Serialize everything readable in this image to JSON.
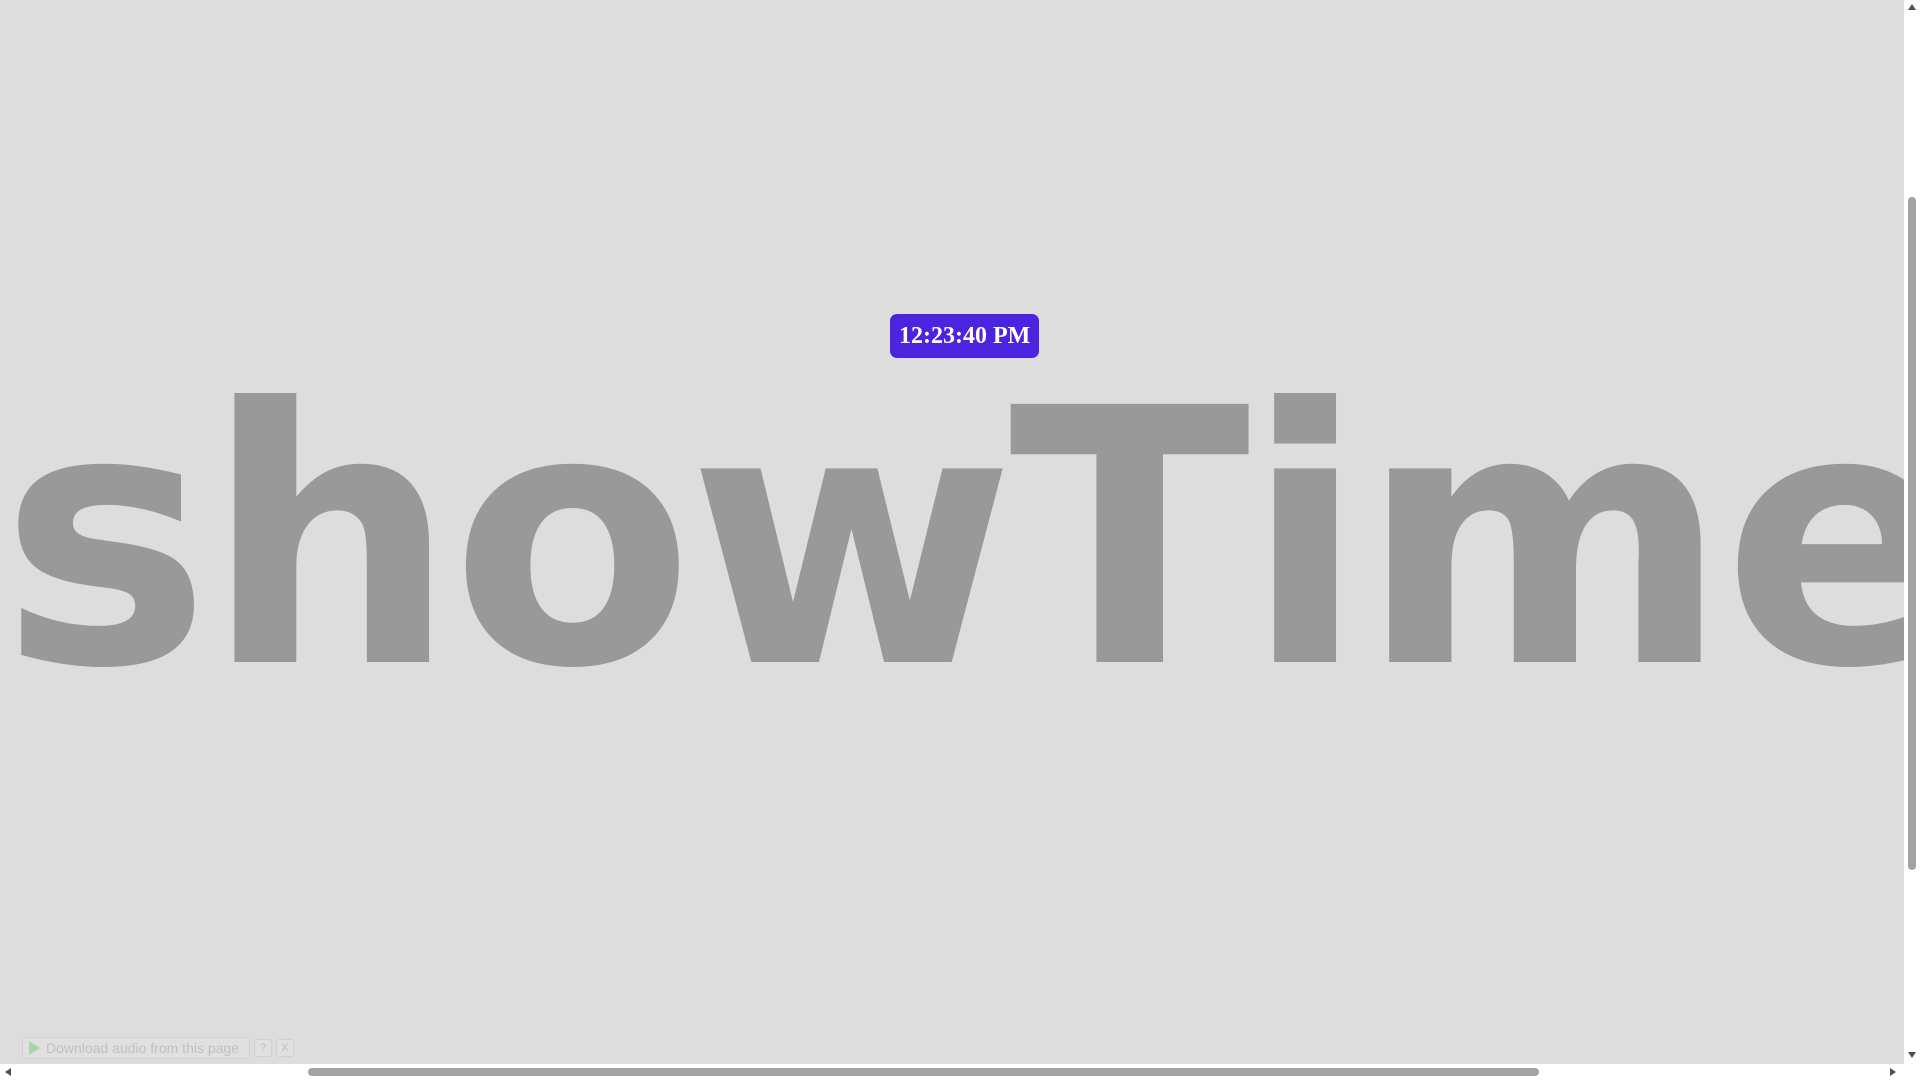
{
  "clock": {
    "time": "12:23:40 PM",
    "background_color": "#4b24e0"
  },
  "title": {
    "text": "showTime",
    "color": "#999999"
  },
  "page": {
    "background_color": "#dddddd"
  },
  "audio_bar": {
    "download_label": "Download audio from this page",
    "help_label": "?",
    "close_label": "X",
    "icon": "play-icon"
  },
  "scrollbars": {
    "vertical_icon_up": "arrow-up-icon",
    "vertical_icon_down": "arrow-down-icon",
    "horizontal_icon_left": "arrow-left-icon",
    "horizontal_icon_right": "arrow-right-icon"
  }
}
